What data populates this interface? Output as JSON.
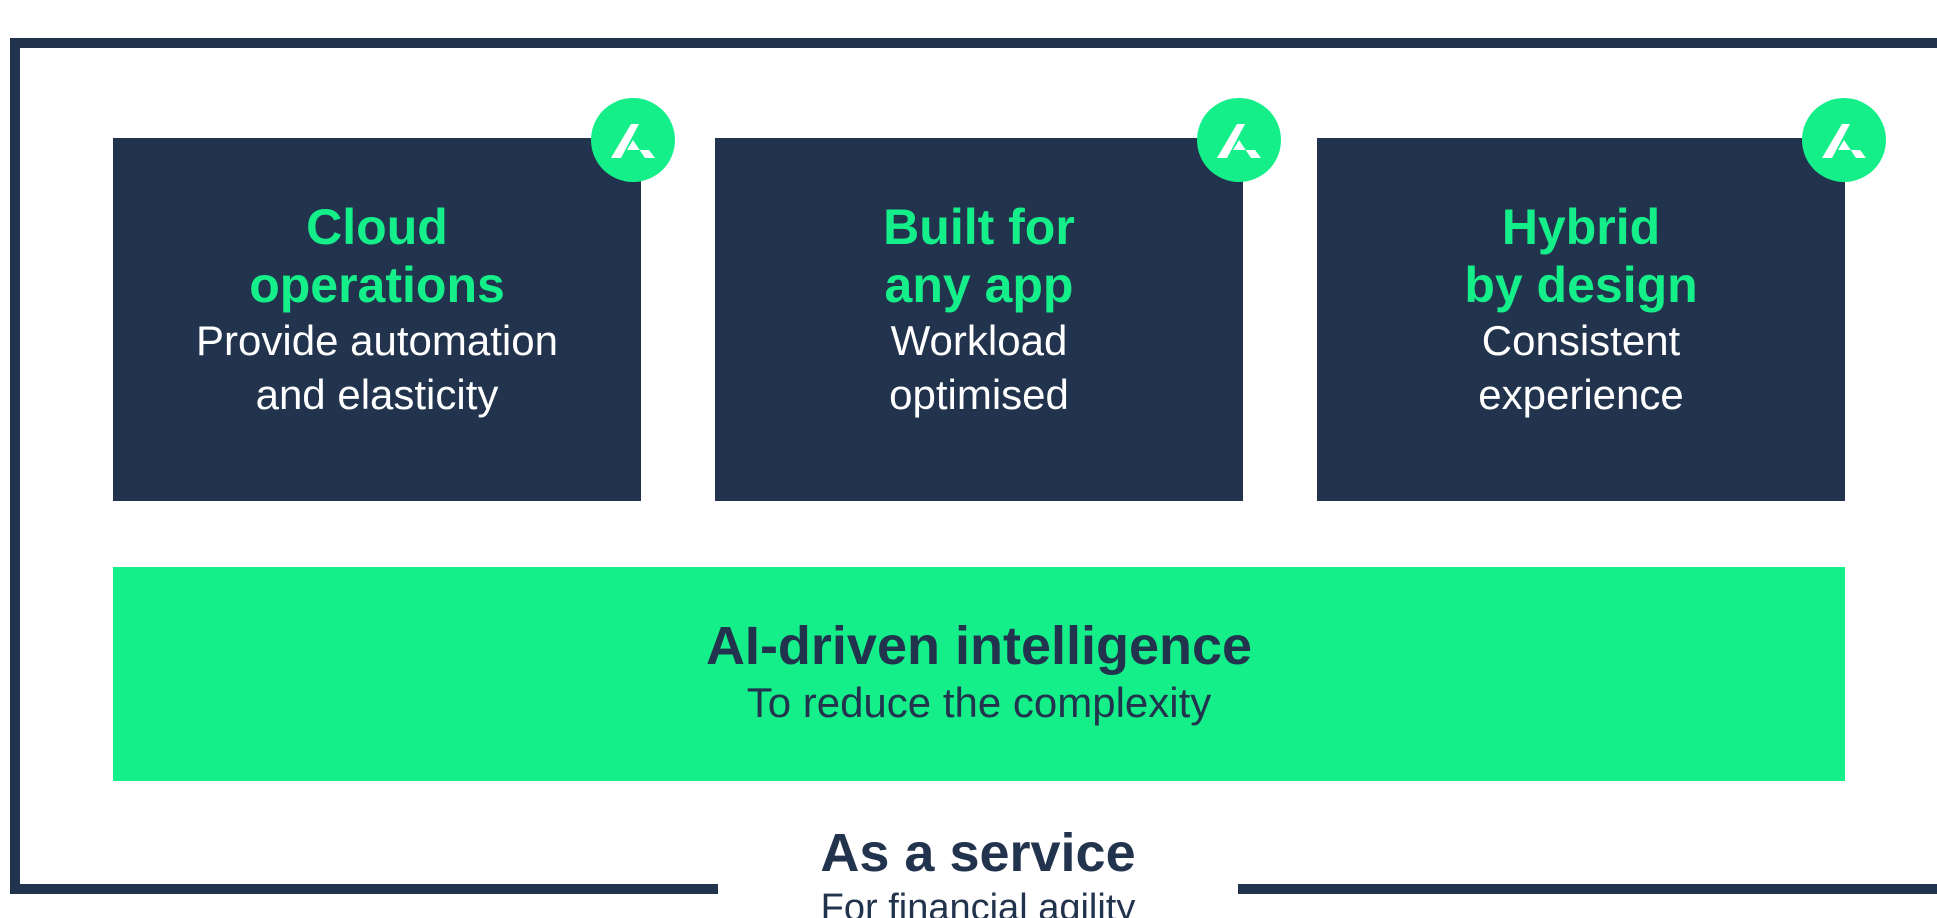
{
  "colors": {
    "navy": "#22334d",
    "green": "#15ef8a",
    "white": "#ffffff"
  },
  "cards": [
    {
      "title": "Cloud\noperations",
      "subtitle": "Provide automation\nand elasticity",
      "icon": "logo-mark-icon"
    },
    {
      "title": "Built for\nany app",
      "subtitle": "Workload\noptimised",
      "icon": "logo-mark-icon"
    },
    {
      "title": "Hybrid\nby design",
      "subtitle": "Consistent\nexperience",
      "icon": "logo-mark-icon"
    }
  ],
  "ai_bar": {
    "title": "AI-driven intelligence",
    "subtitle": "To reduce the complexity"
  },
  "service": {
    "title": "As a service",
    "subtitle": "For financial agility"
  }
}
